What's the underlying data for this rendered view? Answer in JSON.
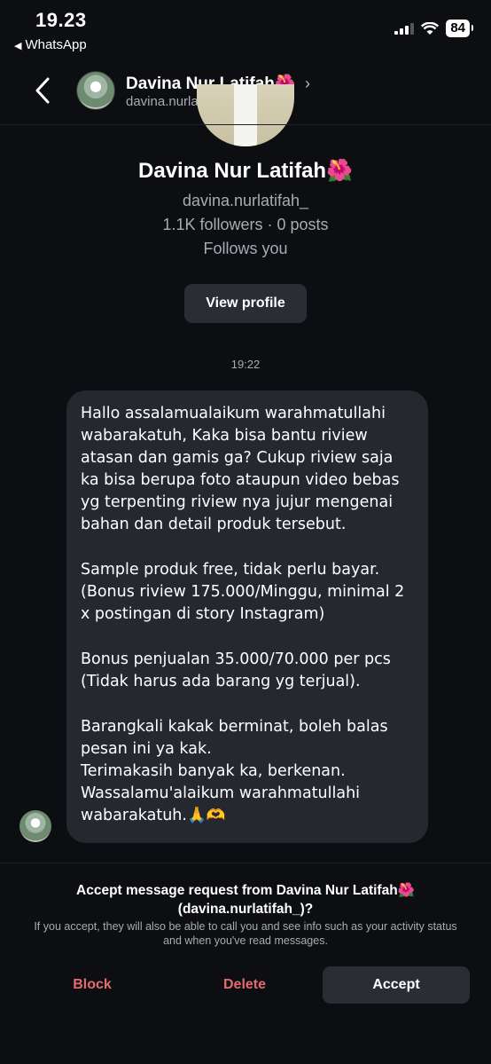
{
  "status_bar": {
    "time": "19.23",
    "back_app": "WhatsApp",
    "battery": "84"
  },
  "header": {
    "name": "Davina Nur Latifah🌺",
    "username": "davina.nurlatifah_"
  },
  "profile": {
    "name": "Davina Nur Latifah🌺",
    "username": "davina.nurlatifah_",
    "stats": "1.1K followers · 0 posts",
    "follows": "Follows you",
    "view_profile_label": "View profile"
  },
  "thread": {
    "timestamp": "19:22",
    "message": {
      "p1": "Hallo assalamualaikum warahmatullahi wabarakatuh, Kaka bisa bantu riview atasan dan gamis ga? Cukup riview saja ka bisa berupa foto ataupun video bebas yg terpenting riview nya jujur mengenai bahan dan detail produk tersebut.",
      "p2": "Sample produk free, tidak perlu bayar.\n(Bonus riview 175.000/Minggu, minimal 2 x postingan di story Instagram)",
      "p3": "Bonus penjualan 35.000/70.000 per pcs\n(Tidak harus ada barang yg terjual).",
      "p4": "Barangkali kakak berminat, boleh balas pesan ini ya kak.\nTerimakasih banyak ka, berkenan.\nWassalamu'alaikum warahmatullahi wabarakatuh.🙏🫶"
    }
  },
  "request": {
    "title": "Accept message request from Davina Nur Latifah🌺 (davina.nurlatifah_)?",
    "note": "If you accept, they will also be able to call you and see info such as your activity status and when you've read messages.",
    "block_label": "Block",
    "delete_label": "Delete",
    "accept_label": "Accept"
  },
  "colors": {
    "background": "#0c0e12",
    "bubble": "#25282e",
    "button": "#2a2d34",
    "destructive": "#e56a6e",
    "secondary_text": "#a8abb3"
  },
  "icons": [
    "back-arrow-icon",
    "chevron-right-icon",
    "signal-icon",
    "wifi-icon",
    "battery-icon"
  ]
}
